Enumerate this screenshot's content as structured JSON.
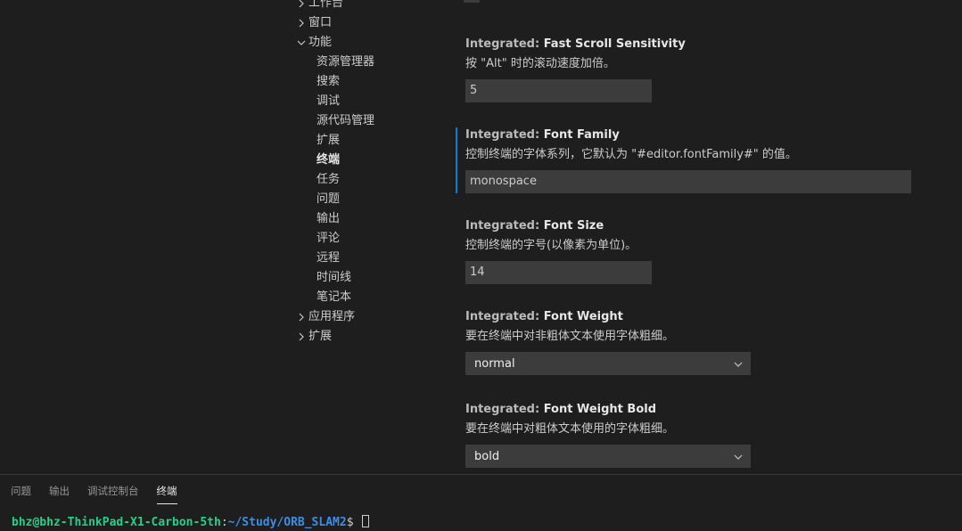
{
  "toc": {
    "items": [
      {
        "label": "工作台",
        "level": 0,
        "expanded": false
      },
      {
        "label": "窗口",
        "level": 0,
        "expanded": false
      },
      {
        "label": "功能",
        "level": 0,
        "expanded": true
      },
      {
        "label": "资源管理器",
        "level": 1
      },
      {
        "label": "搜索",
        "level": 1
      },
      {
        "label": "调试",
        "level": 1
      },
      {
        "label": "源代码管理",
        "level": 1
      },
      {
        "label": "扩展",
        "level": 1
      },
      {
        "label": "终端",
        "level": 1,
        "active": true
      },
      {
        "label": "任务",
        "level": 1
      },
      {
        "label": "问题",
        "level": 1
      },
      {
        "label": "输出",
        "level": 1
      },
      {
        "label": "评论",
        "level": 1
      },
      {
        "label": "远程",
        "level": 1
      },
      {
        "label": "时间线",
        "level": 1
      },
      {
        "label": "笔记本",
        "level": 1
      },
      {
        "label": "应用程序",
        "level": 0,
        "expanded": false
      },
      {
        "label": "扩展",
        "level": 0,
        "expanded": false
      }
    ]
  },
  "settings": {
    "fast_scroll": {
      "category": "Integrated: ",
      "name": "Fast Scroll Sensitivity",
      "description": "按 \"Alt\" 时的滚动速度加倍。",
      "value": "5"
    },
    "font_family": {
      "category": "Integrated: ",
      "name": "Font Family",
      "description": "控制终端的字体系列，它默认为 \"#editor.fontFamily#\" 的值。",
      "value": "monospace"
    },
    "font_size": {
      "category": "Integrated: ",
      "name": "Font Size",
      "description": "控制终端的字号(以像素为单位)。",
      "value": "14"
    },
    "font_weight": {
      "category": "Integrated: ",
      "name": "Font Weight",
      "description": "要在终端中对非粗体文本使用字体粗细。",
      "value": "normal"
    },
    "font_weight_bold": {
      "category": "Integrated: ",
      "name": "Font Weight Bold",
      "description": "要在终端中对粗体文本使用的字体粗细。",
      "value": "bold"
    }
  },
  "panel": {
    "tabs": [
      {
        "label": "问题"
      },
      {
        "label": "输出"
      },
      {
        "label": "调试控制台"
      },
      {
        "label": "终端",
        "active": true
      }
    ],
    "terminal": {
      "user": "bhz@bhz-ThinkPad-X1-Carbon-5th",
      "separator": ":",
      "path": "~/Study/ORB_SLAM2",
      "prompt": "$ "
    }
  },
  "colors": {
    "background": "#1e1e1e",
    "input_background": "#3c3c3c",
    "focus_border": "#007fd4",
    "terminal_green": "#23d18b",
    "terminal_blue": "#3b8eea"
  }
}
